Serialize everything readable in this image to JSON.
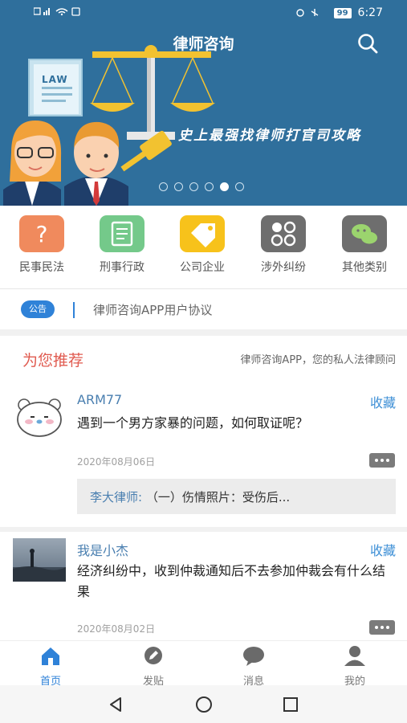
{
  "status_bar": {
    "time": "6:27",
    "battery": "99"
  },
  "header": {
    "title": "律师咨询",
    "banner_slogan": "史上最强找律师打官司攻略",
    "banner_book_label": "LAW",
    "carousel_total": 6,
    "carousel_active_index": 4
  },
  "categories": [
    {
      "label": "民事民法",
      "icon": "question-icon",
      "color": "#f08a5d"
    },
    {
      "label": "刑事行政",
      "icon": "document-icon",
      "color": "#74c98a"
    },
    {
      "label": "公司企业",
      "icon": "tag-icon",
      "color": "#f7c21b"
    },
    {
      "label": "涉外纠纷",
      "icon": "grid-icon",
      "color": "#6e6e6e"
    },
    {
      "label": "其他类别",
      "icon": "wechat-icon",
      "color": "#6e6e6e"
    }
  ],
  "notice": {
    "badge": "公告",
    "text": "律师咨询APP用户协议"
  },
  "recommend": {
    "title": "为您推荐",
    "subtitle": "律师咨询APP，您的私人法律顾问"
  },
  "posts": [
    {
      "author": "ARM77",
      "fav_label": "收藏",
      "question": "遇到一个男方家暴的问题，如何取证呢？",
      "date": "2020年08月06日",
      "reply_author": "李大律师:",
      "reply_text": "（一）伤情照片：受伤后..."
    },
    {
      "author": "我是小杰",
      "fav_label": "收藏",
      "question": "经济纠纷中，收到仲裁通知后不去参加仲裁会有什么结果",
      "date": "2020年08月02日"
    }
  ],
  "tabbar": [
    {
      "label": "首页",
      "icon": "home-icon",
      "active": true
    },
    {
      "label": "发贴",
      "icon": "compose-icon",
      "active": false
    },
    {
      "label": "消息",
      "icon": "chat-icon",
      "active": false
    },
    {
      "label": "我的",
      "icon": "person-icon",
      "active": false
    }
  ],
  "colors": {
    "banner_bg": "#2f6f9c",
    "accent_blue": "#2f82d8",
    "recommend_red": "#e05a4f"
  }
}
